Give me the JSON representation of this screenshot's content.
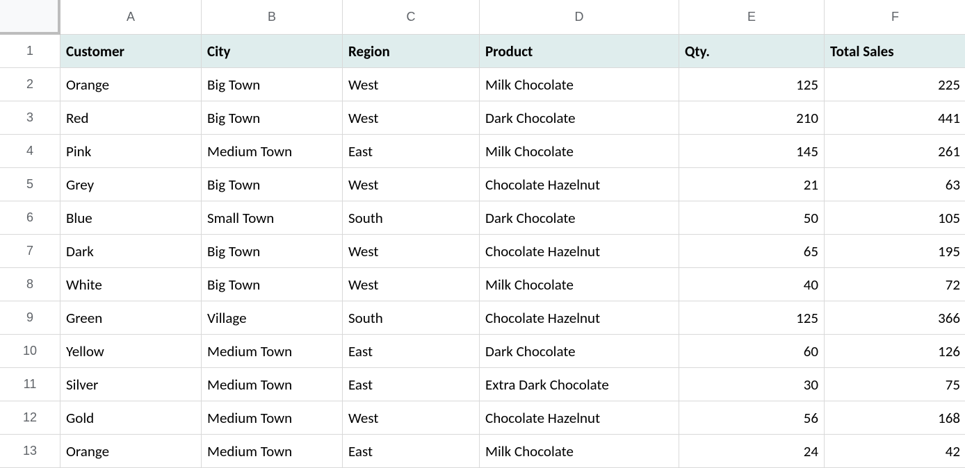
{
  "columns": [
    "A",
    "B",
    "C",
    "D",
    "E",
    "F"
  ],
  "rowNumbers": [
    "1",
    "2",
    "3",
    "4",
    "5",
    "6",
    "7",
    "8",
    "9",
    "10",
    "11",
    "12",
    "13"
  ],
  "headers": {
    "customer": "Customer",
    "city": "City",
    "region": "Region",
    "product": "Product",
    "qty": "Qty.",
    "total": "Total Sales"
  },
  "rows": [
    {
      "customer": "Orange",
      "city": "Big Town",
      "region": "West",
      "product": "Milk Chocolate",
      "qty": "125",
      "total": "225"
    },
    {
      "customer": "Red",
      "city": "Big Town",
      "region": "West",
      "product": "Dark Chocolate",
      "qty": "210",
      "total": "441"
    },
    {
      "customer": "Pink",
      "city": "Medium Town",
      "region": "East",
      "product": "Milk Chocolate",
      "qty": "145",
      "total": "261"
    },
    {
      "customer": "Grey",
      "city": "Big Town",
      "region": "West",
      "product": "Chocolate Hazelnut",
      "qty": "21",
      "total": "63"
    },
    {
      "customer": "Blue",
      "city": "Small Town",
      "region": "South",
      "product": "Dark Chocolate",
      "qty": "50",
      "total": "105"
    },
    {
      "customer": "Dark",
      "city": "Big Town",
      "region": "West",
      "product": "Chocolate Hazelnut",
      "qty": "65",
      "total": "195"
    },
    {
      "customer": "White",
      "city": "Big Town",
      "region": "West",
      "product": "Milk Chocolate",
      "qty": "40",
      "total": "72"
    },
    {
      "customer": "Green",
      "city": "Village",
      "region": "South",
      "product": "Chocolate Hazelnut",
      "qty": "125",
      "total": "366"
    },
    {
      "customer": "Yellow",
      "city": "Medium Town",
      "region": "East",
      "product": "Dark Chocolate",
      "qty": "60",
      "total": "126"
    },
    {
      "customer": "Silver",
      "city": "Medium Town",
      "region": "East",
      "product": "Extra Dark Chocolate",
      "qty": "30",
      "total": "75"
    },
    {
      "customer": "Gold",
      "city": "Medium Town",
      "region": "West",
      "product": "Chocolate Hazelnut",
      "qty": "56",
      "total": "168"
    },
    {
      "customer": "Orange",
      "city": "Medium Town",
      "region": "East",
      "product": "Milk Chocolate",
      "qty": "24",
      "total": "42"
    }
  ]
}
